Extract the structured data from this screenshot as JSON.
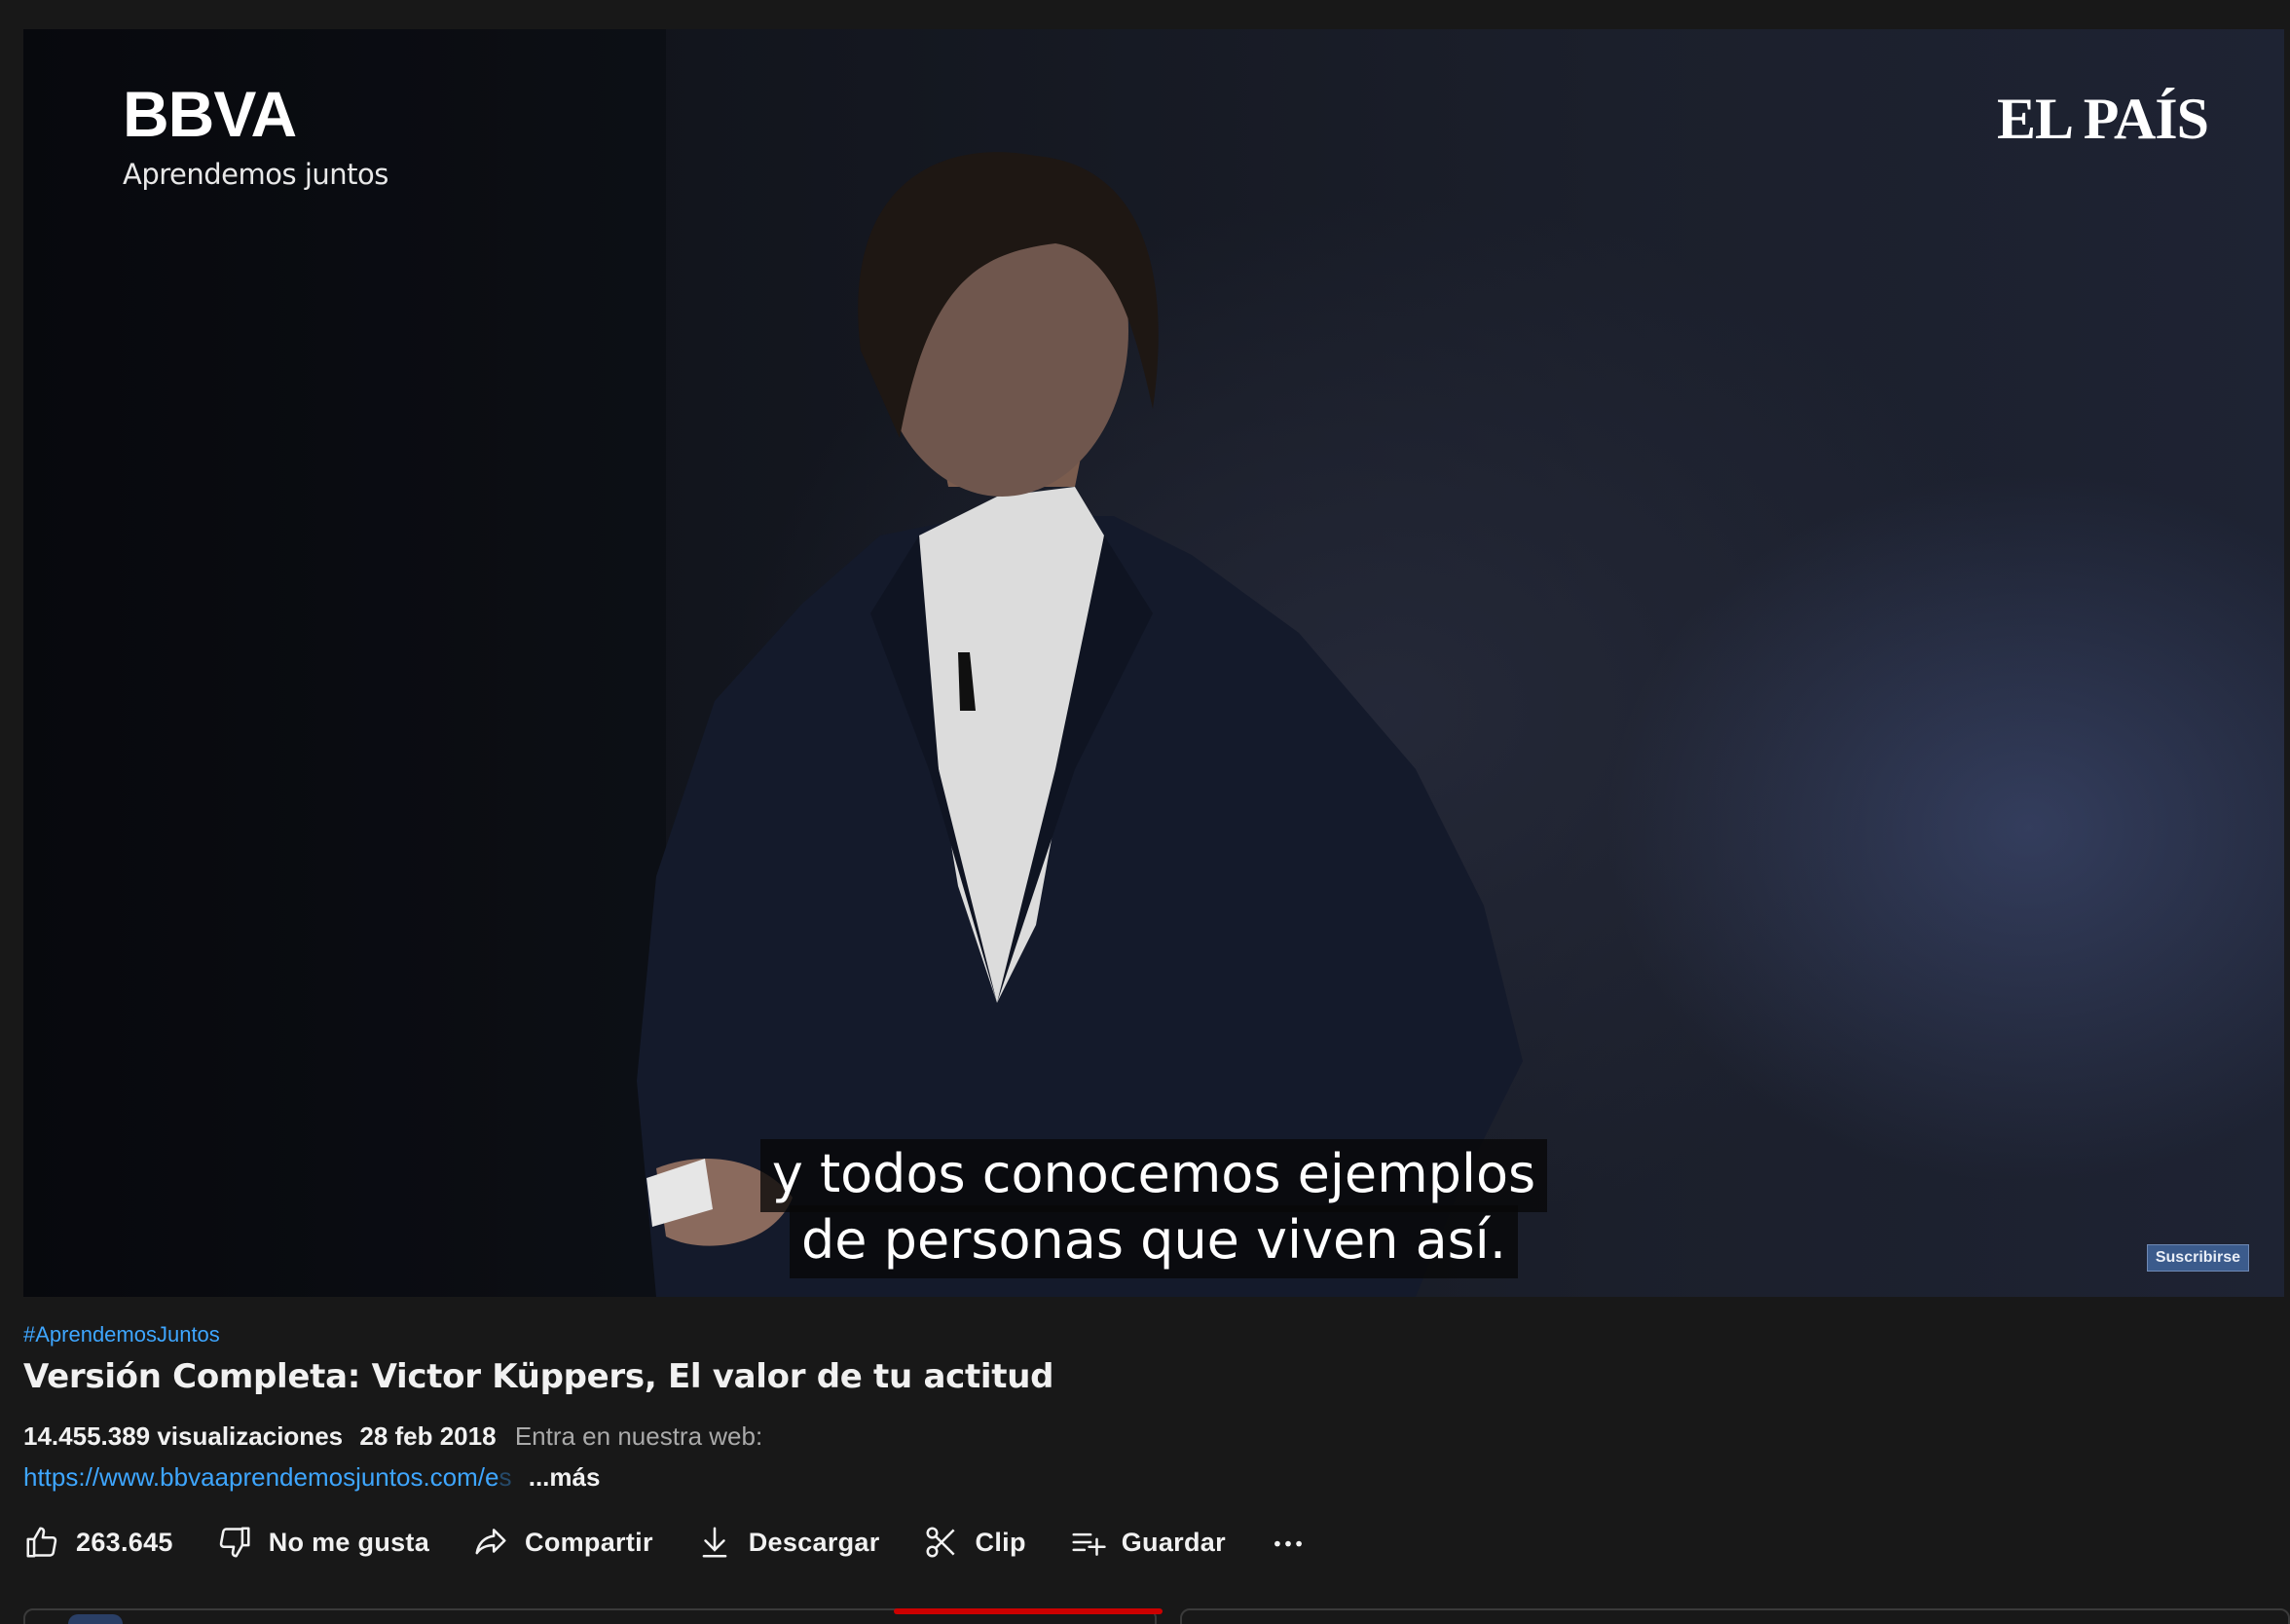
{
  "player": {
    "logo_left": {
      "brand": "BBVA",
      "tagline": "Aprendemos juntos"
    },
    "logo_right": "EL PAÍS",
    "captions": [
      "y todos conocemos ejemplos",
      "de personas que viven así."
    ],
    "watermark_button": "Suscribirse"
  },
  "video": {
    "hashtag": "#AprendemosJuntos",
    "title": "Versión Completa: Victor Küppers, El valor de tu actitud",
    "views": "14.455.389 visualizaciones",
    "date": "28 feb 2018",
    "description_preview": "Entra en nuestra web:",
    "link": "https://www.bbvaaprendemosjuntos.com/e",
    "link_fade": "s",
    "more_label": "...más"
  },
  "actions": [
    {
      "label": "263.645",
      "icon": "thumbs-up-icon"
    },
    {
      "label": "No me gusta",
      "icon": "thumbs-down-icon"
    },
    {
      "label": "Compartir",
      "icon": "share-icon"
    },
    {
      "label": "Descargar",
      "icon": "download-icon"
    },
    {
      "label": "Clip",
      "icon": "scissors-icon"
    },
    {
      "label": "Guardar",
      "icon": "playlist-add-icon"
    },
    {
      "label": "",
      "icon": "more-horizontal-icon"
    }
  ],
  "colors": {
    "background": "#181818",
    "link": "#3ea6ff",
    "text": "#f1f1f1",
    "muted": "#aaaaaa",
    "subscribe_watermark": "#3b5b8c"
  }
}
